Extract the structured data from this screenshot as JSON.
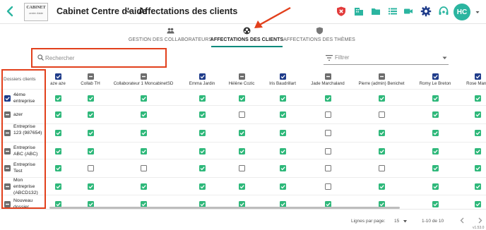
{
  "header": {
    "logo_text": "CABINET",
    "logo_subtext": "centre d'aide",
    "app_title": "Cabinet Centre d'aide",
    "page_title": "Affectations des clients",
    "avatar_initials": "HC",
    "icons": [
      "shield-alert-icon",
      "building-icon",
      "folder-icon",
      "list-icon",
      "video-icon",
      "gear-icon",
      "support-headset-icon"
    ]
  },
  "tabs": [
    {
      "label": "GESTION DES COLLABORATEURS",
      "icon": "people-icon",
      "active": false
    },
    {
      "label": "AFFECTATIONS DES CLIENTS",
      "icon": "clients-icon",
      "active": true
    },
    {
      "label": "AFFECTATIONS DES THÈMES",
      "icon": "shield-icon",
      "active": false
    }
  ],
  "search": {
    "placeholder": "Rechercher",
    "value": ""
  },
  "filter": {
    "label": "Filtrer"
  },
  "grid": {
    "row_header": "Dossiers clients",
    "columns": [
      {
        "label": "aze aze",
        "header_state": "on"
      },
      {
        "label": "Collab TH",
        "header_state": "mid"
      },
      {
        "label": "Collaborateur 1 MoncabinetSD",
        "header_state": "mid"
      },
      {
        "label": "Emma Jardin",
        "header_state": "on"
      },
      {
        "label": "Hélène Cozic",
        "header_state": "mid"
      },
      {
        "label": "Iris Baudrillart",
        "header_state": "on"
      },
      {
        "label": "Jade Marchaland",
        "header_state": "mid"
      },
      {
        "label": "Pierre (admin) Benichet",
        "header_state": "mid"
      },
      {
        "label": "Romy Le Breton",
        "header_state": "on"
      },
      {
        "label": "Rose Manu",
        "header_state": "on"
      }
    ],
    "rows": [
      {
        "label": "4ème entreprise",
        "state": "on",
        "cells": [
          1,
          1,
          1,
          1,
          1,
          1,
          1,
          1,
          1,
          1
        ]
      },
      {
        "label": "azer",
        "state": "mid",
        "cells": [
          1,
          1,
          1,
          1,
          0,
          1,
          0,
          0,
          1,
          1
        ]
      },
      {
        "label": "Entreprise 123 (987654)",
        "state": "mid",
        "cells": [
          1,
          1,
          1,
          1,
          1,
          1,
          0,
          1,
          1,
          1
        ]
      },
      {
        "label": "Entreprise ABC (ABC)",
        "state": "mid",
        "cells": [
          1,
          1,
          1,
          1,
          1,
          1,
          0,
          1,
          1,
          1
        ]
      },
      {
        "label": "Entreprise Test",
        "state": "mid",
        "cells": [
          1,
          0,
          0,
          1,
          0,
          1,
          0,
          0,
          1,
          1
        ]
      },
      {
        "label": "Mon entreprise (ABCD132)",
        "state": "mid",
        "cells": [
          1,
          1,
          1,
          1,
          1,
          1,
          0,
          1,
          1,
          1
        ]
      },
      {
        "label": "Nouveau dossier",
        "state": "mid",
        "cells": [
          1,
          1,
          1,
          1,
          1,
          1,
          1,
          1,
          1,
          1
        ]
      }
    ]
  },
  "footer": {
    "rows_per_page_label": "Lignes par page:",
    "rows_per_page_value": "15",
    "range_text": "1-10 de 10",
    "version": "v1.53.0"
  },
  "colors": {
    "accent": "#00897b",
    "check_on": "#2eb87a",
    "header_check": "#1f3c8a",
    "indeterminate": "#6c6c6c",
    "annotation": "#e2401c",
    "avatar": "#2bb5a0"
  }
}
